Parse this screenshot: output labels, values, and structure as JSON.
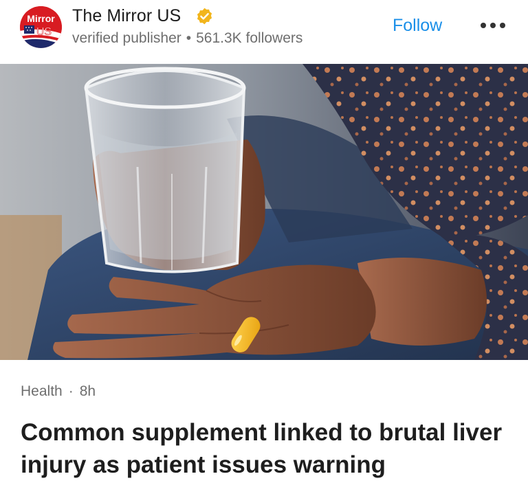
{
  "publisher": {
    "logo_text_top": "Mirror",
    "logo_text_bottom": "US",
    "name": "The Mirror US",
    "verified_icon": "verified-badge-icon",
    "status": "verified publisher",
    "followers": "561.3K followers",
    "follow_label": "Follow",
    "more_icon": "more-options-icon"
  },
  "hero_image": {
    "alt": "Hand holding a glass of water and a yellow capsule pill"
  },
  "article": {
    "category": "Health",
    "age": "8h",
    "headline": "Common supplement linked to brutal liver injury as patient issues warning"
  },
  "colors": {
    "brand_red": "#d81c22",
    "follow_blue": "#1a8fe8",
    "verified_gold": "#f2b51c",
    "pill_yellow": "#f5b523"
  }
}
